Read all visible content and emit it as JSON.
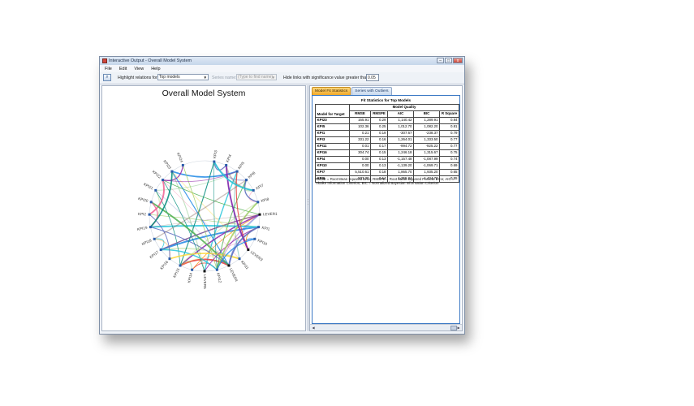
{
  "window": {
    "title": "Interactive Output - Overall Model System",
    "buttons": {
      "minimize": "–",
      "maximize": "□",
      "close": "x"
    }
  },
  "menu": [
    "File",
    "Edit",
    "View",
    "Help"
  ],
  "toolbar": {
    "highlight_label": "Highlight relations for:",
    "highlight_value": "Top models",
    "series_label": "Series name:",
    "series_placeholder": "(Type to find name)",
    "hide_label": "Hide links with significance value greater than:",
    "hide_value": "0.05"
  },
  "chart": {
    "title": "Overall Model System",
    "node_labels": [
      "KPI3",
      "KPI4",
      "KPI5",
      "KPI6",
      "KPI7",
      "KPI8",
      "LEVER1",
      "KPI1",
      "KPI10",
      "LEVER3",
      "KPI11",
      "LEVER4",
      "KPI12",
      "LEVER5",
      "KPI14",
      "KPI15",
      "KPI16",
      "KPI17",
      "KPI18",
      "KPI19",
      "KPI2",
      "KPI20",
      "KPI21",
      "KPI22",
      "KPI23",
      "KPI24"
    ]
  },
  "tabs": [
    "Model Fit Statistics",
    "Series with Outliers"
  ],
  "fit_table": {
    "title": "Fit Statistics for Top Models",
    "group_header": "Model Quality",
    "corner_header": "Model for Target",
    "columns": [
      "RMSE",
      "RMSPE",
      "AIC",
      "BIC",
      "R Square"
    ],
    "rows": [
      {
        "name": "KPI23",
        "values": [
          "165.91",
          "0.29",
          "1,140.42",
          "1,289.91",
          "0.84"
        ]
      },
      {
        "name": "KPI5",
        "values": [
          "102.36",
          "0.25",
          "1,012.70",
          "1,082.20",
          "0.81"
        ]
      },
      {
        "name": "KPI1",
        "values": [
          "0.21",
          "0.19",
          "-307.67",
          "-238.37",
          "0.79"
        ]
      },
      {
        "name": "KPI3",
        "values": [
          "331.22",
          "0.16",
          "1,264.01",
          "1,333.50",
          "0.77"
        ]
      },
      {
        "name": "KPI11",
        "values": [
          "0.01",
          "0.17",
          "-994.72",
          "-925.22",
          "0.77"
        ]
      },
      {
        "name": "KPI16",
        "values": [
          "304.74",
          "0.15",
          "1,246.18",
          "1,315.67",
          "0.75"
        ]
      },
      {
        "name": "KPI4",
        "values": [
          "0.00",
          "0.13",
          "-1,157.48",
          "-1,087.99",
          "0.74"
        ]
      },
      {
        "name": "KPI10",
        "values": [
          "0.00",
          "0.13",
          "-1,139.20",
          "-1,069.71",
          "0.69"
        ]
      },
      {
        "name": "KPI7",
        "values": [
          "5,510.61",
          "0.18",
          "1,865.70",
          "1,935.20",
          "0.65"
        ]
      },
      {
        "name": "KPI6",
        "values": [
          "507.30",
          "0.14",
          "1,355.24",
          "1,424.73",
          "0.55"
        ]
      }
    ],
    "footnote": "RMSE = Root Mean Squared Error, RMSPE = Root Mean Squared Percent Error, AIC = Akaike Information Criterion, BIC = Normalized Bayesian Information Criterion"
  },
  "colors": {
    "accent_tab": "#f0a92a",
    "frame_blue": "#3a78c4",
    "link_colors": [
      "#4caf50",
      "#e53935",
      "#1e88e5",
      "#fb8c00",
      "#8e24aa",
      "#00897b",
      "#f06292",
      "#9ccc65",
      "#5c6bc0",
      "#fdd835",
      "#26c6da",
      "#6d4c41"
    ]
  }
}
